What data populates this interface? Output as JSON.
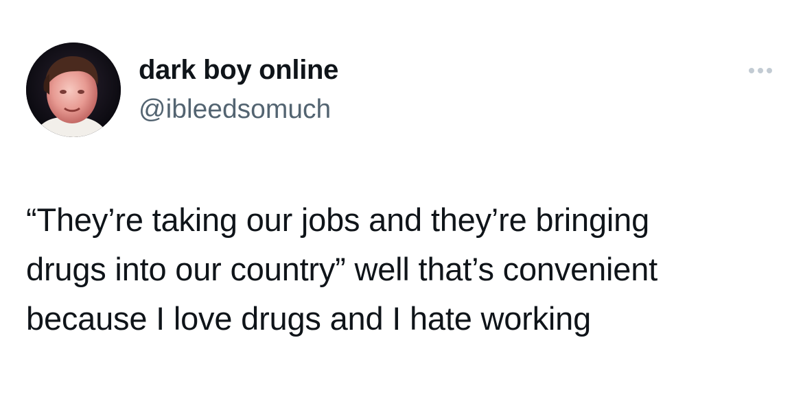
{
  "author": {
    "display_name": "dark boy online",
    "handle": "@ibleedsomuch",
    "avatar_icon": "profile-photo"
  },
  "more_menu": {
    "icon": "more-horizontal-icon"
  },
  "tweet": {
    "lines": [
      "“They’re taking our jobs and they’re bringing",
      "drugs into our country” well that’s convenient",
      "because I love drugs and I hate working"
    ]
  },
  "colors": {
    "text_primary": "#0f1419",
    "text_secondary": "#536471",
    "background": "#ffffff",
    "more_dots": "#c2cbd3"
  }
}
